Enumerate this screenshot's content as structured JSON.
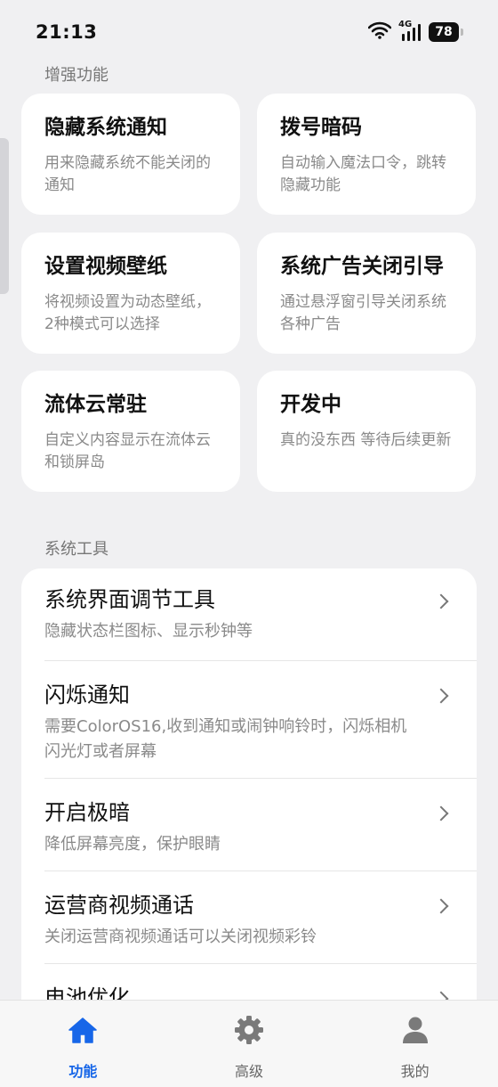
{
  "status_bar": {
    "time": "21:13",
    "network": "4G",
    "battery": "78"
  },
  "features": {
    "section_title": "增强功能",
    "cards": [
      {
        "title": "隐藏系统通知",
        "desc": "用来隐藏系统不能关闭的通知"
      },
      {
        "title": "拨号暗码",
        "desc": "自动输入魔法口令，跳转隐藏功能"
      },
      {
        "title": "设置视频壁纸",
        "desc": "将视频设置为动态壁纸，2种模式可以选择"
      },
      {
        "title": "系统广告关闭引导",
        "desc": "通过悬浮窗引导关闭系统各种广告"
      },
      {
        "title": "流体云常驻",
        "desc": "自定义内容显示在流体云和锁屏岛"
      },
      {
        "title": "开发中",
        "desc": "真的没东西 等待后续更新"
      }
    ]
  },
  "tools": {
    "section_title": "系统工具",
    "items": [
      {
        "title": "系统界面调节工具",
        "desc": "隐藏状态栏图标、显示秒钟等"
      },
      {
        "title": "闪烁通知",
        "desc": "需要ColorOS16,收到通知或闹钟响铃时，闪烁相机闪光灯或者屏幕"
      },
      {
        "title": "开启极暗",
        "desc": "降低屏幕亮度，保护眼睛"
      },
      {
        "title": "运营商视频通话",
        "desc": "关闭运营商视频通话可以关闭视频彩铃"
      },
      {
        "title": "电池优化",
        "desc": ""
      }
    ]
  },
  "bottom_nav": {
    "items": [
      {
        "label": "功能",
        "icon": "home-icon",
        "active": true
      },
      {
        "label": "高级",
        "icon": "gear-icon",
        "active": false
      },
      {
        "label": "我的",
        "icon": "person-icon",
        "active": false
      }
    ]
  },
  "colors": {
    "accent": "#1766e8",
    "background": "#f0f0f2",
    "card": "#ffffff",
    "muted_text": "#8a8a8a"
  }
}
